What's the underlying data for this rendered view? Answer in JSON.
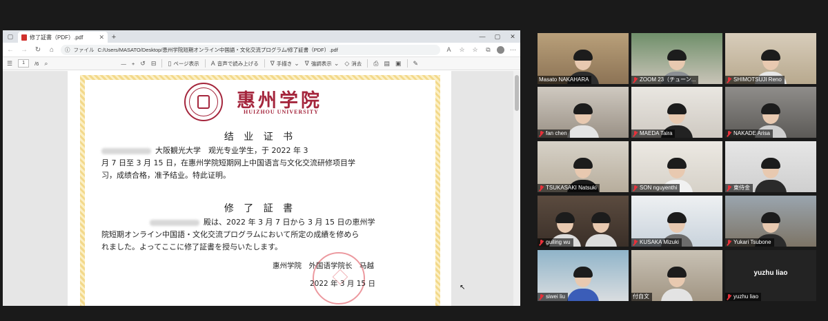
{
  "browser": {
    "tab_title": "修了証書（PDF）.pdf",
    "url_scheme": "ファイル",
    "url": "C:/Users/MASATO/Desktop/恵州学院短期オンライン中国語・文化交流プログラム/修了証書（PDF）.pdf"
  },
  "pdf_toolbar": {
    "page_number": "1",
    "page_total": "/6",
    "zoom_minus": "—",
    "zoom_plus": "+",
    "page_view": "ページ表示",
    "read_aloud": "音声で読み上げる",
    "draw": "手描き",
    "highlight": "強調表示",
    "erase": "消去"
  },
  "certificate": {
    "university_cn": "惠州学院",
    "university_en": "HUIZHOU UNIVERSITY",
    "heading_cn": "结 业 证 书",
    "body_cn_line1": "大阪観光大学　观光专业学生，于 2022 年 3",
    "body_cn_line2": "月 7 日至 3 月 15 日，在惠州学院短期网上中国语言与文化交流研修项目学",
    "body_cn_line3": "习，成绩合格，准予结业。特此证明。",
    "heading_jp": "修 了 証 書",
    "body_jp_line1": "殿は、2022 年 3 月 7 日から 3 月 15 日の恵州学",
    "body_jp_line2": "院短期オンライン中国語・文化交流プログラムにおいて所定の成績を修めら",
    "body_jp_line3": "れました。よってここに修了証書を授与いたします。",
    "signer": "惠州学院　外国语学院长　马越",
    "date": "2022 年 3 月 15 日"
  },
  "participants": [
    {
      "name": "Masato NAKAHARA",
      "muted": false
    },
    {
      "name": "ZOOM 23（チューン...",
      "muted": true
    },
    {
      "name": "SHIMOTSUJI Reno",
      "muted": true
    },
    {
      "name": "fan chen",
      "muted": true
    },
    {
      "name": "MAEDA Taira",
      "muted": true
    },
    {
      "name": "NAKADE Arisa",
      "muted": true
    },
    {
      "name": "TSUKASAKI Natsuki",
      "muted": true
    },
    {
      "name": "SON nguyenthi",
      "muted": true
    },
    {
      "name": "東侍金",
      "muted": true
    },
    {
      "name": "guiling wu",
      "muted": true
    },
    {
      "name": "KUSAKA Mizuki",
      "muted": true
    },
    {
      "name": "Yukari Tsubone",
      "muted": true
    },
    {
      "name": "siwei liu",
      "muted": true
    },
    {
      "name": "付自文",
      "muted": false
    },
    {
      "name": "yuzhu liao",
      "muted": true
    }
  ],
  "no_video_name": "yuzhu liao",
  "colors": {
    "accent_university": "#a4253c",
    "active_speaker": "#b7d84b",
    "muted_mic": "#e8313a"
  }
}
